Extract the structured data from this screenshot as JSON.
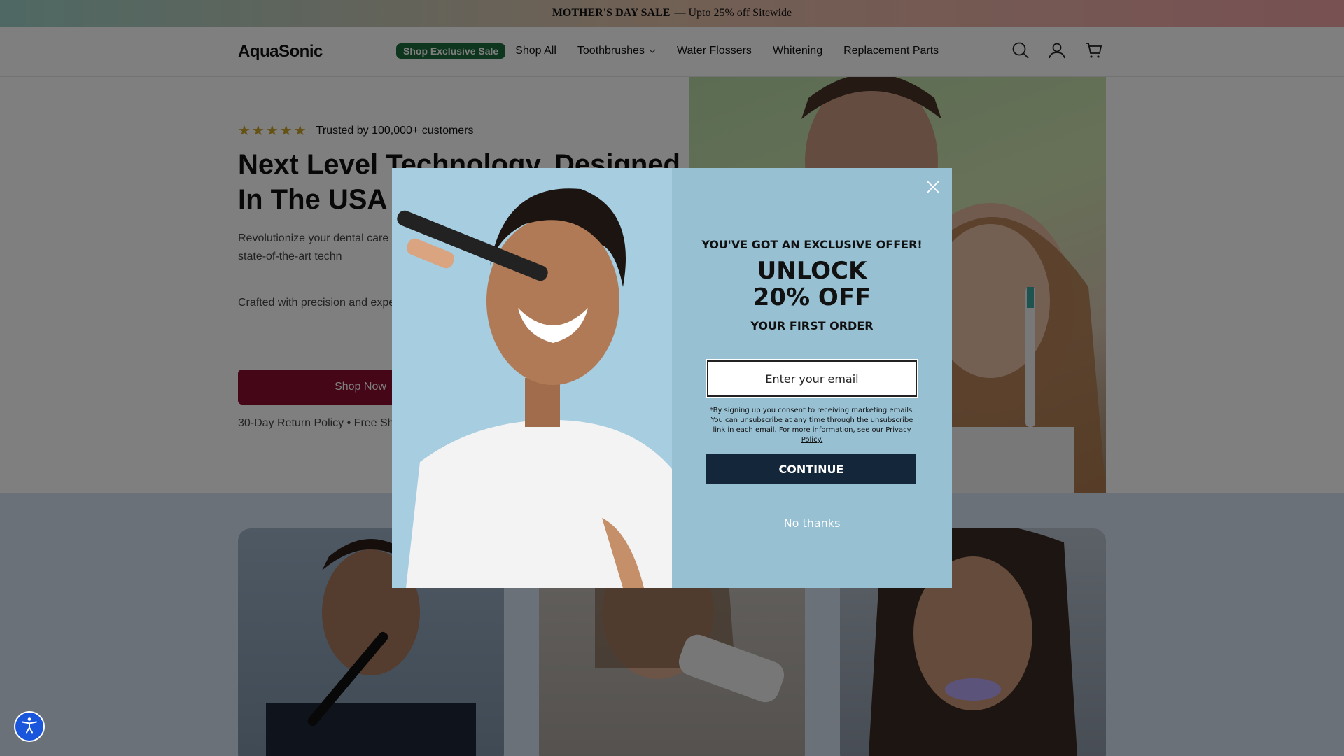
{
  "announcement": {
    "sale": "MOTHER'S DAY SALE",
    "text": "— Upto 25% off Sitewide"
  },
  "header": {
    "logo": "AquaSonic",
    "nav": {
      "sale_pill": "Shop Exclusive Sale",
      "shop_all": "Shop All",
      "toothbrushes": "Toothbrushes",
      "water_flossers": "Water Flossers",
      "whitening": "Whitening",
      "replacement_parts": "Replacement Parts"
    },
    "icons": [
      "search-icon",
      "account-icon",
      "cart-icon"
    ]
  },
  "hero": {
    "rating_stars": "★★★★★",
    "trusted": "Trusted by 100,000+ customers",
    "title": "Next Level Technology, Designed In The USA",
    "paragraph1": "Revolutionize your dental care r care products. From achieving a gums, our state-of-the-art techn",
    "paragraph2": "Crafted with precision and expe adored by customers worldwide",
    "cta": "Shop Now",
    "policy": "30-Day Return Policy • Free Shi"
  },
  "modal": {
    "kicker": "YOU'VE GOT AN EXCLUSIVE OFFER!",
    "unlock_line1": "UNLOCK",
    "unlock_line2": "20% OFF",
    "first_order": "YOUR FIRST ORDER",
    "email_placeholder": "Enter your email",
    "legal": "*By signing up you consent to receiving marketing emails. You can unsubscribe at any time through the unsubscribe link in each email. For more information, see our",
    "privacy_link": "Privacy Policy.",
    "continue": "CONTINUE",
    "no_thanks": "No thanks"
  },
  "colors": {
    "brand_sale_pill": "#1c6b3a",
    "cta_maroon": "#8a0e2f",
    "modal_bg": "#97c0d3",
    "continue_bg": "#13263a",
    "accessibility_blue": "#1a56db"
  }
}
